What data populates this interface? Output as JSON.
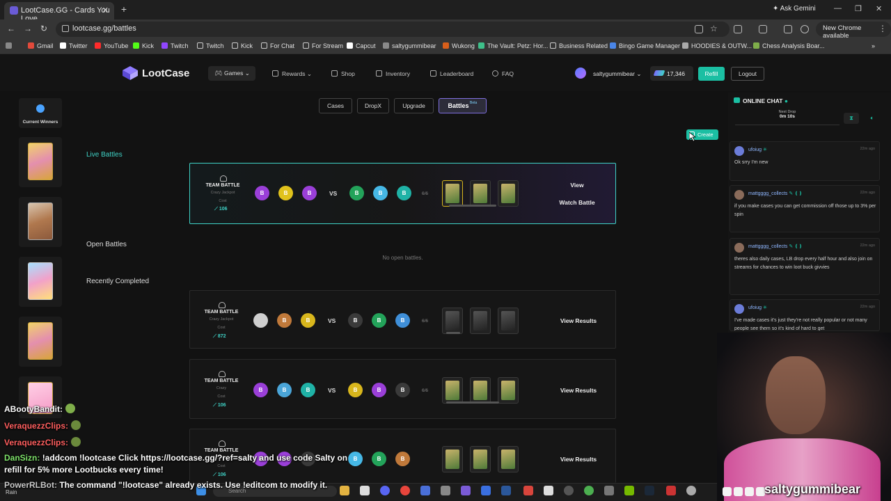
{
  "browser": {
    "tab_title": "LootCase.GG - Cards You Love",
    "address": "lootcase.gg/battles",
    "gemini": "Ask Gemini",
    "new_chrome": "New Chrome available",
    "bookmarks": [
      "Gmail",
      "Twitter",
      "YouTube",
      "Kick",
      "Twitch",
      "Twitch",
      "Kick",
      "For Chat",
      "For Stream",
      "Capcut",
      "saltygummibear",
      "Wukong",
      "The Vault: Petz: Hor...",
      "Business Related",
      "Bingo Game Manager",
      "HOODIES & OUTW...",
      "Chess Analysis Boar..."
    ]
  },
  "site": {
    "logo": "LootCase",
    "nav": {
      "games": "Games",
      "rewards": "Rewards",
      "shop": "Shop",
      "inventory": "Inventory",
      "leaderboard": "Leaderboard",
      "faq": "FAQ"
    },
    "username": "saltygummibear",
    "balance": "17,346",
    "refill": "Refill",
    "logout": "Logout"
  },
  "left": {
    "current_winners": "Current Winners"
  },
  "modes": {
    "cases": "Cases",
    "dropx": "DropX",
    "upgrade": "Upgrade",
    "battles": "Battles",
    "beta": "Beta"
  },
  "create": "Create",
  "sections": {
    "live": "Live Battles",
    "open": "Open Battles",
    "recent": "Recently Completed",
    "no_open": "No open battles."
  },
  "battles": [
    {
      "title": "TEAM BATTLE",
      "sub": "Crazy Jackpot",
      "cost_label": "Cost",
      "cost": "106",
      "ratio": "6/6",
      "players": [
        "B",
        "B",
        "B",
        "B",
        "B",
        "B"
      ],
      "colors": [
        "#9a3fd8",
        "#e0c21c",
        "#9a3fd8",
        "#23a35a",
        "#46b8e6",
        "#1fb2a6"
      ],
      "actions": [
        "View",
        "Watch Battle"
      ]
    },
    {
      "title": "TEAM BATTLE",
      "sub": "Crazy Jackpot",
      "cost_label": "Cost",
      "cost": "872",
      "ratio": "6/6",
      "players": [
        "",
        "B",
        "B",
        "B",
        "B",
        "B"
      ],
      "colors": [
        "#cfcfcf",
        "#c0793a",
        "#d8b61c",
        "#3a3a3a",
        "#23a35a",
        "#3f8fd8"
      ],
      "actions": [
        "View Results"
      ]
    },
    {
      "title": "TEAM BATTLE",
      "sub": "Crazy",
      "cost_label": "Cost",
      "cost": "106",
      "ratio": "6/6",
      "players": [
        "B",
        "B",
        "B",
        "B",
        "B",
        "B"
      ],
      "colors": [
        "#9a3fd8",
        "#4aa5d8",
        "#1fb2a6",
        "#d8b61c",
        "#9a3fd8",
        "#3a3a3a"
      ],
      "actions": [
        "View Results"
      ]
    },
    {
      "title": "TEAM BATTLE",
      "sub": "Crazy",
      "cost_label": "Cost",
      "cost": "106",
      "ratio": "6/6",
      "players": [
        "B",
        "B",
        "B",
        "B",
        "B",
        "B"
      ],
      "colors": [
        "#9a3fd8",
        "#9a3fd8",
        "#3a3a3a",
        "#46b8e6",
        "#23a35a",
        "#c0793a"
      ],
      "actions": [
        "View Results"
      ]
    }
  ],
  "vs": "VS",
  "chat": {
    "title": "ONLINE CHAT",
    "drop_label": "Next Drop",
    "drop_time": "0m 10s",
    "messages": [
      {
        "user": "ufoiug",
        "time": "22m ago",
        "text": "Ok srry I'm new"
      },
      {
        "user": "mattgggg_collects",
        "time": "22m ago",
        "text": "if you make cases you can get commission off those up to 3% per spin"
      },
      {
        "user": "mattgggg_collects",
        "time": "22m ago",
        "text": "theres also daily cases, LB drop every half hour and also join on streams for chances to win loot buck givvies"
      },
      {
        "user": "ufoiug",
        "time": "22m ago",
        "text": "I've made cases it's just they're not really popular or not many people see them so it's kind of hard to get"
      }
    ]
  },
  "stream": {
    "chat": [
      {
        "name": "ABootyBandit:",
        "text": ""
      },
      {
        "name": "VeraquezzClips:",
        "text": ""
      },
      {
        "name": "VeraquezzClips:",
        "text": ""
      },
      {
        "name": "DanSizn:",
        "text": "!addcom !lootcase Click https://lootcase.gg/?ref=salty and use code Salty on"
      },
      {
        "name": "",
        "text": "refill for 5% more Lootbucks every time!"
      },
      {
        "name": "PowerRLBot:",
        "text": "The command \"!lootcase\" already exists. Use !editcom to modify it."
      }
    ],
    "handle": "saltygummibear"
  },
  "taskbar": {
    "search": "Search",
    "weather": "Rain"
  }
}
